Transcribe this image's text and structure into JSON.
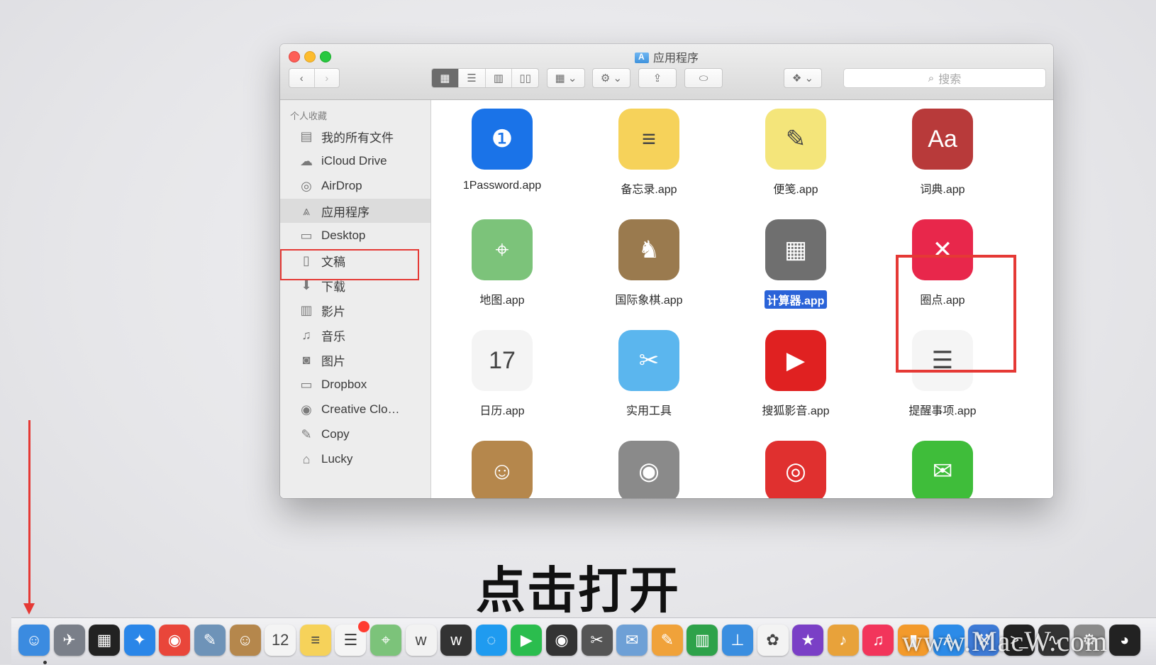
{
  "window": {
    "title": "应用程序",
    "search_placeholder": "搜索"
  },
  "sidebar": {
    "header": "个人收藏",
    "items": [
      {
        "label": "我的所有文件",
        "icon": "all-files-icon",
        "glyph": "▤"
      },
      {
        "label": "iCloud Drive",
        "icon": "cloud-icon",
        "glyph": "☁"
      },
      {
        "label": "AirDrop",
        "icon": "airdrop-icon",
        "glyph": "◎"
      },
      {
        "label": "应用程序",
        "icon": "applications-icon",
        "glyph": "⩓"
      },
      {
        "label": "Desktop",
        "icon": "desktop-icon",
        "glyph": "▭"
      },
      {
        "label": "文稿",
        "icon": "documents-icon",
        "glyph": "▯"
      },
      {
        "label": "下载",
        "icon": "downloads-icon",
        "glyph": "⬇"
      },
      {
        "label": "影片",
        "icon": "movies-icon",
        "glyph": "▥"
      },
      {
        "label": "音乐",
        "icon": "music-icon",
        "glyph": "♫"
      },
      {
        "label": "图片",
        "icon": "pictures-icon",
        "glyph": "◙"
      },
      {
        "label": "Dropbox",
        "icon": "folder-icon",
        "glyph": "▭"
      },
      {
        "label": "Creative Clo…",
        "icon": "creative-cloud-icon",
        "glyph": "◉"
      },
      {
        "label": "Copy",
        "icon": "copy-icon",
        "glyph": "✎"
      },
      {
        "label": "Lucky",
        "icon": "home-icon",
        "glyph": "⌂"
      }
    ]
  },
  "apps": [
    {
      "label": "1Password.app",
      "icon": "1password-icon",
      "glyph": "❶",
      "color": "#1a73e8"
    },
    {
      "label": "备忘录.app",
      "icon": "notes-icon",
      "glyph": "≡",
      "color": "#f6d25a"
    },
    {
      "label": "便笺.app",
      "icon": "stickies-icon",
      "glyph": "✎",
      "color": "#f4e57a"
    },
    {
      "label": "词典.app",
      "icon": "dictionary-icon",
      "glyph": "Aa",
      "color": "#b83a3a"
    },
    {
      "label": "地图.app",
      "icon": "maps-icon",
      "glyph": "⌖",
      "color": "#7cc37a"
    },
    {
      "label": "国际象棋.app",
      "icon": "chess-icon",
      "glyph": "♞",
      "color": "#9a7a4e"
    },
    {
      "label": "计算器.app",
      "icon": "calculator-icon",
      "glyph": "▦",
      "color": "#6f6f6f"
    },
    {
      "label": "圈点.app",
      "icon": "skitch-icon",
      "glyph": "✕",
      "color": "#e8274b"
    },
    {
      "label": "日历.app",
      "icon": "calendar-icon",
      "glyph": "17",
      "color": "#f4f4f4"
    },
    {
      "label": "实用工具",
      "icon": "utilities-folder-icon",
      "glyph": "✂",
      "color": "#5bb6ee"
    },
    {
      "label": "搜狐影音.app",
      "icon": "sohu-video-icon",
      "glyph": "▶",
      "color": "#e02121"
    },
    {
      "label": "提醒事项.app",
      "icon": "reminders-icon",
      "glyph": "☰",
      "color": "#f5f5f5"
    },
    {
      "label": "",
      "icon": "contacts-icon",
      "glyph": "☺",
      "color": "#b5874c"
    },
    {
      "label": "",
      "icon": "image-capture-icon",
      "glyph": "◉",
      "color": "#8a8a8a"
    },
    {
      "label": "",
      "icon": "netease-music-icon",
      "glyph": "◎",
      "color": "#e0302f"
    },
    {
      "label": "",
      "icon": "wechat-icon",
      "glyph": "✉",
      "color": "#3fbd3a"
    }
  ],
  "subtitle": "点击打开",
  "watermark": "www.MacW.com",
  "dock": [
    {
      "icon": "finder-icon",
      "glyph": "☺",
      "color": "#3b8be0"
    },
    {
      "icon": "launchpad-icon",
      "glyph": "✈",
      "color": "#7a7f89"
    },
    {
      "icon": "mission-control-icon",
      "glyph": "▦",
      "color": "#222222"
    },
    {
      "icon": "safari-icon",
      "glyph": "✦",
      "color": "#2a86e8"
    },
    {
      "icon": "chrome-icon",
      "glyph": "◉",
      "color": "#e9463a"
    },
    {
      "icon": "preview-icon",
      "glyph": "✎",
      "color": "#6e93b8"
    },
    {
      "icon": "contacts-dock-icon",
      "glyph": "☺",
      "color": "#b5874c"
    },
    {
      "icon": "calendar-dock-icon",
      "glyph": "12",
      "color": "#f4f4f4"
    },
    {
      "icon": "notes-dock-icon",
      "glyph": "≡",
      "color": "#f6d25a"
    },
    {
      "icon": "reminders-dock-icon",
      "glyph": "☰",
      "color": "#f5f5f5"
    },
    {
      "icon": "maps-dock-icon",
      "glyph": "⌖",
      "color": "#7cc37a"
    },
    {
      "icon": "writer-icon",
      "glyph": "w",
      "color": "#f2f2f2"
    },
    {
      "icon": "writer-dark-icon",
      "glyph": "w",
      "color": "#333333"
    },
    {
      "icon": "messages-icon",
      "glyph": "◌",
      "color": "#1f9bf0"
    },
    {
      "icon": "facetime-icon",
      "glyph": "▶",
      "color": "#2bbd4e"
    },
    {
      "icon": "photo-booth-icon",
      "glyph": "◉",
      "color": "#333333"
    },
    {
      "icon": "final-cut-icon",
      "glyph": "✂",
      "color": "#555555"
    },
    {
      "icon": "mail-icon",
      "glyph": "✉",
      "color": "#6ea0d6"
    },
    {
      "icon": "pages-icon",
      "glyph": "✎",
      "color": "#f0a23a"
    },
    {
      "icon": "numbers-icon",
      "glyph": "▥",
      "color": "#2ea24a"
    },
    {
      "icon": "keynote-icon",
      "glyph": "⊥",
      "color": "#3a8ee0"
    },
    {
      "icon": "photos-icon",
      "glyph": "✿",
      "color": "#f3f3f3"
    },
    {
      "icon": "imovie-icon",
      "glyph": "★",
      "color": "#7a3fc6"
    },
    {
      "icon": "garageband-icon",
      "glyph": "♪",
      "color": "#e8a23a"
    },
    {
      "icon": "itunes-icon",
      "glyph": "♫",
      "color": "#f2355b"
    },
    {
      "icon": "ibooks-icon",
      "glyph": "▮",
      "color": "#f39a2b"
    },
    {
      "icon": "app-store-icon",
      "glyph": "A",
      "color": "#2c8be8"
    },
    {
      "icon": "xcode-icon",
      "glyph": "⚒",
      "color": "#3d7ad6"
    },
    {
      "icon": "terminal-icon",
      "glyph": ">_",
      "color": "#222222"
    },
    {
      "icon": "activity-monitor-icon",
      "glyph": "∿",
      "color": "#333333"
    },
    {
      "icon": "system-preferences-icon",
      "glyph": "⚙",
      "color": "#8a8a8a"
    },
    {
      "icon": "qq-icon",
      "glyph": "◕",
      "color": "#222222"
    }
  ]
}
